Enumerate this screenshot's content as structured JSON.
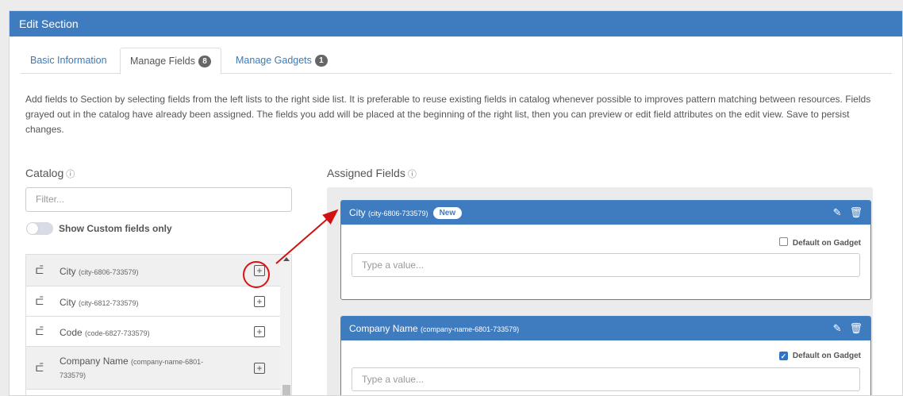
{
  "panel": {
    "title": "Edit Section"
  },
  "tabs": [
    {
      "label": "Basic Information",
      "badge": ""
    },
    {
      "label": "Manage Fields",
      "badge": "8"
    },
    {
      "label": "Manage Gadgets",
      "badge": "1"
    }
  ],
  "description": "Add fields to Section by selecting fields from the left lists to the right side list. It is preferable to reuse existing fields in catalog whenever possible to improves pattern matching between resources. Fields grayed out in the catalog have already been assigned. The fields you add will be placed at the beginning of the right list, then you can preview or edit field attributes on the edit view. Save to persist changes.",
  "catalog": {
    "title": "Catalog",
    "info_icon": "ⓘ",
    "filter_placeholder": "Filter...",
    "toggle_label": "Show Custom fields only",
    "items": [
      {
        "name": "City",
        "id": "(city-6806-733579)"
      },
      {
        "name": "City",
        "id": "(city-6812-733579)"
      },
      {
        "name": "Code",
        "id": "(code-6827-733579)"
      },
      {
        "name": "Company Name",
        "id": "(company-name-6801-733579)"
      }
    ]
  },
  "assigned": {
    "title": "Assigned Fields",
    "info_icon": "ⓘ",
    "fields": [
      {
        "name": "City",
        "id": "(city-6806-733579)",
        "badge": "New",
        "gadget_label": "Default on Gadget",
        "gadget_checked": false,
        "placeholder": "Type a value..."
      },
      {
        "name": "Company Name",
        "id": "(company-name-6801-733579)",
        "badge": "",
        "gadget_label": "Default on Gadget",
        "gadget_checked": true,
        "placeholder": "Type a value..."
      }
    ]
  },
  "icons": {
    "field": "field-type-icon",
    "add": "add-box-icon",
    "edit": "pencil-icon",
    "delete": "trash-icon"
  },
  "colors": {
    "header_blue": "#3f7bbf",
    "tab_link": "#3b7ab8",
    "annotation_red": "#d11111"
  }
}
